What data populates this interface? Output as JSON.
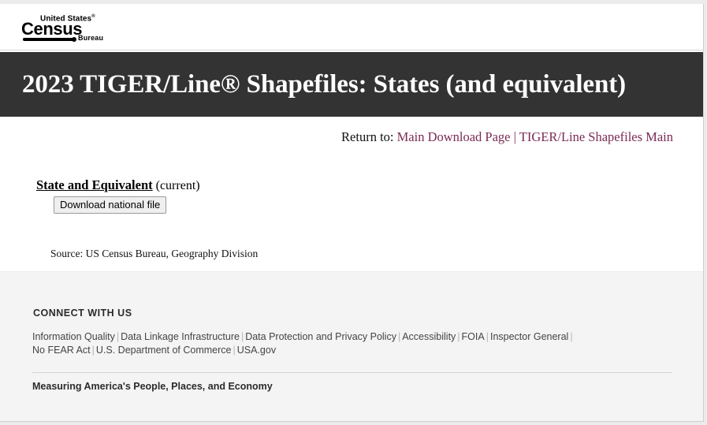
{
  "browser": {
    "page_background": "#ffffff",
    "chrome_background": "#ececec"
  },
  "masthead": {
    "logo": {
      "name": "us-census-bureau-logo",
      "top_text": "United States",
      "registered_mark": "®",
      "main_text": "Census",
      "sub_text": "Bureau"
    }
  },
  "banner": {
    "title": "2023 TIGER/Line® Shapefiles: States (and equivalent)",
    "background_color": "#333333",
    "text_color": "#ffffff"
  },
  "return_bar": {
    "label": "Return to:",
    "links": [
      {
        "label": "Main Download Page",
        "name": "main-download-page-link"
      },
      {
        "label": "TIGER/Line Shapefiles Main",
        "name": "tiger-line-shapefiles-main-link"
      }
    ],
    "separator": "|",
    "link_color": "#7b2a55"
  },
  "main": {
    "entity": {
      "name": "State and Equivalent",
      "state": "(current)"
    },
    "download_button": {
      "label": "Download national file"
    },
    "source_note": "Source: US Census Bureau, Geography Division"
  },
  "footer": {
    "heading": "CONNECT WITH US",
    "links_row1": [
      "Information Quality",
      "Data Linkage Infrastructure",
      "Data Protection and Privacy Policy",
      "Accessibility",
      "FOIA",
      "Inspector General"
    ],
    "links_row2": [
      "No FEAR Act",
      "U.S. Department of Commerce",
      "USA.gov"
    ],
    "separator": "|",
    "tagline": "Measuring America's People, Places, and Economy",
    "background_color": "#f4f4f4"
  }
}
